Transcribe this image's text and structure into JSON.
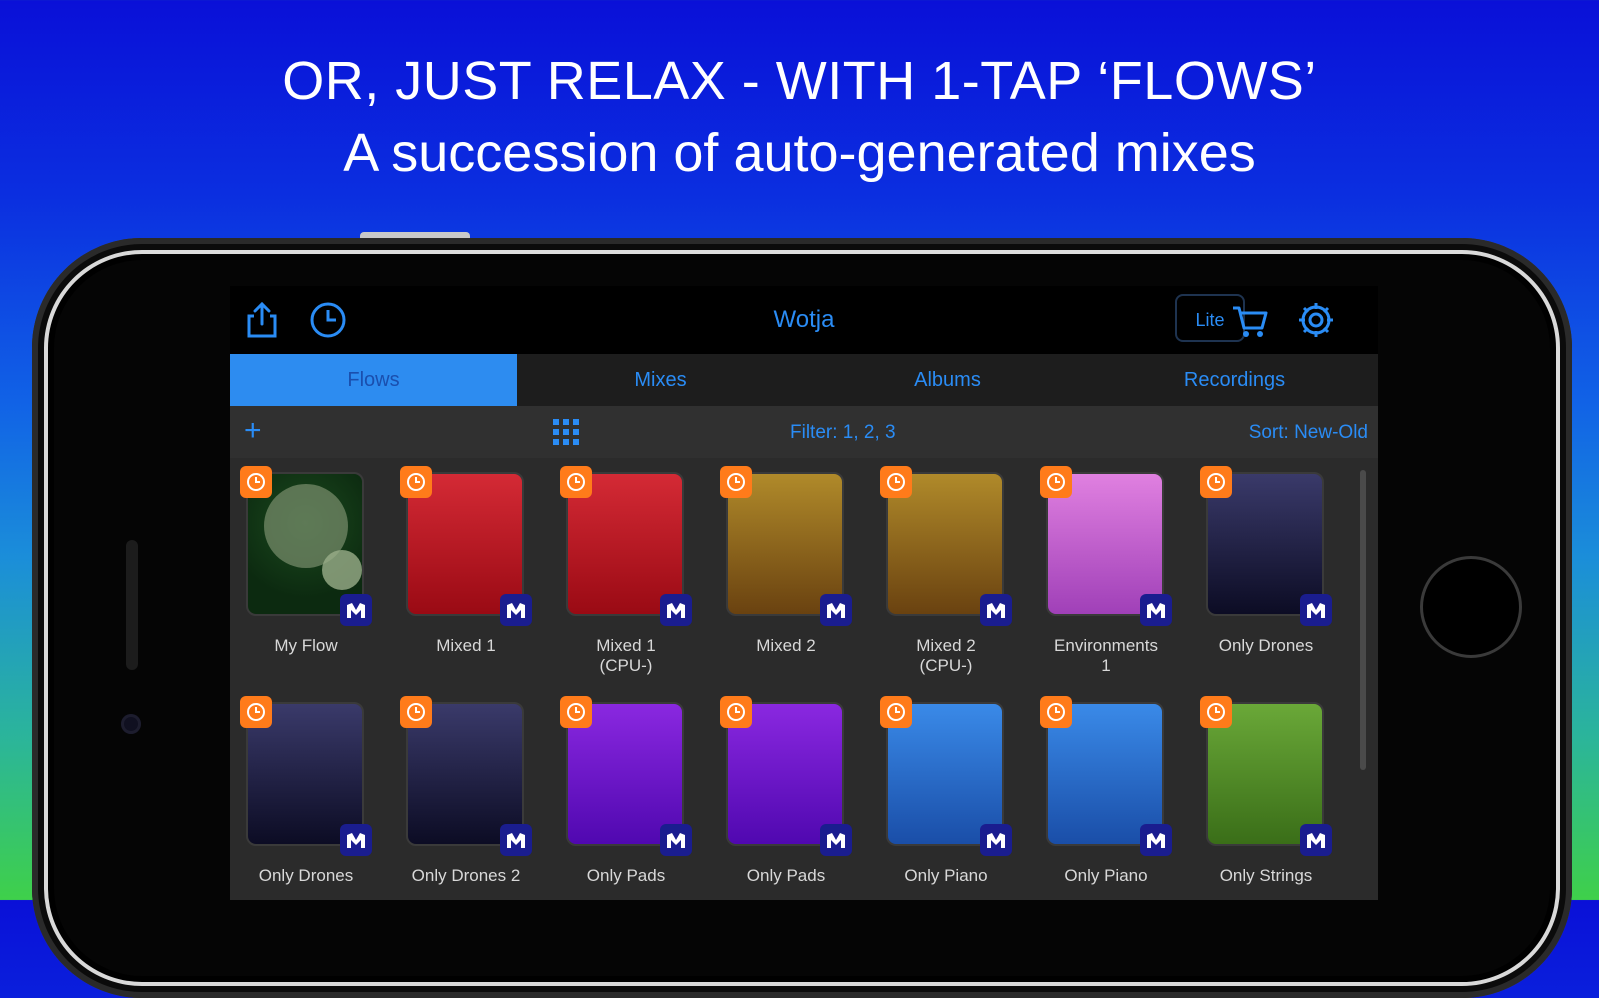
{
  "headline": {
    "line1": "OR, JUST RELAX - WITH 1-TAP ‘FLOWS’",
    "line2": "A succession of auto-generated mixes"
  },
  "topbar": {
    "title": "Wotja",
    "lite_label": "Lite",
    "icons": [
      "share-icon",
      "clock-icon",
      "cart-icon",
      "gear-icon"
    ]
  },
  "tabs": [
    {
      "label": "Flows",
      "active": true
    },
    {
      "label": "Mixes",
      "active": false
    },
    {
      "label": "Albums",
      "active": false
    },
    {
      "label": "Recordings",
      "active": false
    }
  ],
  "toolbar": {
    "add_label": "+",
    "filter_label": "Filter: 1, 2, 3",
    "sort_label": "Sort: New-Old"
  },
  "colors": {
    "accent": "#2a8cf5",
    "badge_orange": "#ff7b1a",
    "badge_navy": "#1a1d8f"
  },
  "tiles": [
    {
      "label": "My Flow",
      "bg": "radial-gradient(circle at 50% 35%, #1b4a1e 0%, #0c2a10 70%)",
      "art": "circles"
    },
    {
      "label": "Mixed 1",
      "bg": "linear-gradient(180deg,#d42a35 0%,#9a0a14 100%)"
    },
    {
      "label": "Mixed 1\n(CPU-)",
      "bg": "linear-gradient(180deg,#d42a35 0%,#9a0a14 100%)"
    },
    {
      "label": "Mixed 2",
      "bg": "linear-gradient(180deg,#b08a2a 0%,#6a4210 100%)"
    },
    {
      "label": "Mixed 2\n(CPU-)",
      "bg": "linear-gradient(180deg,#b08a2a 0%,#6a4210 100%)"
    },
    {
      "label": "Environments\n1",
      "bg": "linear-gradient(180deg,#e080e0 0%,#a040b8 100%)"
    },
    {
      "label": "Only Drones",
      "bg": "linear-gradient(180deg,#3a3a6a 0%,#0c0c24 100%)"
    },
    {
      "label": "Only Drones",
      "bg": "linear-gradient(180deg,#3a3a6a 0%,#0c0c24 100%)"
    },
    {
      "label": "Only Drones 2",
      "bg": "linear-gradient(180deg,#3a3a6a 0%,#0c0c24 100%)"
    },
    {
      "label": "Only Pads",
      "bg": "linear-gradient(180deg,#8a28e0 0%,#5008b0 100%)"
    },
    {
      "label": "Only Pads",
      "bg": "linear-gradient(180deg,#8a28e0 0%,#5008b0 100%)"
    },
    {
      "label": "Only Piano",
      "bg": "linear-gradient(180deg,#3a8ae8 0%,#1a4ea8 100%)"
    },
    {
      "label": "Only Piano",
      "bg": "linear-gradient(180deg,#3a8ae8 0%,#1a4ea8 100%)"
    },
    {
      "label": "Only Strings",
      "bg": "linear-gradient(180deg,#6aa838 0%,#3a6e18 100%)"
    }
  ]
}
